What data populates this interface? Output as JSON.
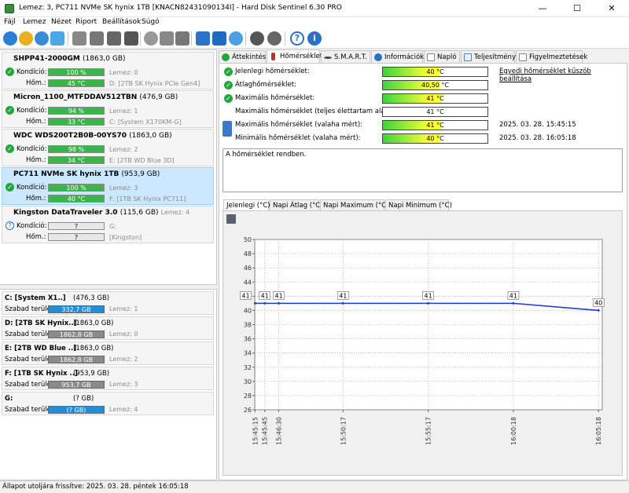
{
  "window": {
    "title": "Lemez: 3, PC711 NVMe SK hynix 1TB [KNACN82431090134I] - Hard Disk Sentinel 6.30 PRO",
    "minimize": "—",
    "maximize": "☐",
    "close": "✕"
  },
  "menu": [
    "Fájl",
    "Lemez",
    "Nézet",
    "Riport",
    "Beállítások",
    "Súgó"
  ],
  "toolbar_icons": [
    "refresh-icon",
    "refresh-all-icon",
    "info-icon",
    "report-icon",
    "disk-test-icon",
    "disk-eject-icon",
    "disk-warning-icon",
    "disk-settings-icon",
    "network-disk-icon",
    "usb-icon",
    "disk-tools-icon",
    "clipboard-icon",
    "email-icon",
    "cloud-icon",
    "settings-gear-icon",
    "alert-settings-icon",
    "help-icon",
    "about-icon"
  ],
  "disks": [
    {
      "name": "SHPP41-2000GM",
      "size": "(1863,0 GB)",
      "condition_label": "Kondíció:",
      "condition": "100 %",
      "disk_no": "Lemez: 0",
      "temp_label": "Hőm.:",
      "temp": "45 °C",
      "volume": "D: [2TB SK Hynix PCIe Gen4]",
      "status": "ok"
    },
    {
      "name": "Micron_1100_MTFDDAV512TBN",
      "size": "(476,9 GB)",
      "condition_label": "Kondíció:",
      "condition": "94 %",
      "disk_no": "Lemez: 1",
      "temp_label": "Hőm.:",
      "temp": "33 °C",
      "volume": "C: [System X170KM-G]",
      "status": "ok"
    },
    {
      "name": "WDC WDS200T2B0B-00YS70",
      "size": "(1863,0 GB)",
      "condition_label": "Kondíció:",
      "condition": "98 %",
      "disk_no": "Lemez: 2",
      "temp_label": "Hőm.:",
      "temp": "34 °C",
      "volume": "E: [2TB WD Blue 3D]",
      "status": "ok"
    },
    {
      "name": "PC711 NVMe SK hynix 1TB",
      "size": "(953,9 GB)",
      "condition_label": "Kondíció:",
      "condition": "100 %",
      "disk_no": "Lemez: 3",
      "temp_label": "Hőm.:",
      "temp": "40 °C",
      "volume": "F: [1TB SK Hynix PC711]",
      "status": "ok"
    },
    {
      "name": "Kingston DataTraveler 3.0",
      "size": "(115,6 GB)",
      "condition_label": "Kondíció:",
      "condition": "?",
      "disk_no": "Lemez: 4",
      "temp_label": "Hőm.:",
      "temp": "?",
      "volume_a": "G:",
      "volume": "[Kingston]",
      "status": "unknown"
    }
  ],
  "volumes": [
    {
      "name": "C: [System X1..]",
      "size": "(476,3 GB)",
      "free_label": "Szabad terület",
      "free": "332,7 GB",
      "disk": "Lemez: 1",
      "color": "blue"
    },
    {
      "name": "D: [2TB SK Hynix..]",
      "size": "(1863,0 GB)",
      "free_label": "Szabad terület",
      "free": "1862,8 GB",
      "disk": "Lemez: 0",
      "color": "gray"
    },
    {
      "name": "E: [2TB WD Blue ..]",
      "size": "(1863,0 GB)",
      "free_label": "Szabad terület",
      "free": "1862,8 GB",
      "disk": "Lemez: 2",
      "color": "gray"
    },
    {
      "name": "F: [1TB SK Hynix ..]",
      "size": "(953,9 GB)",
      "free_label": "Szabad terület",
      "free": "953,7 GB",
      "disk": "Lemez: 3",
      "color": "gray"
    },
    {
      "name": "G:",
      "size": "(? GB)",
      "free_label": "Szabad terület",
      "free": "(? GB)",
      "disk": "Lemez: 4",
      "color": "blue"
    }
  ],
  "tabs": [
    "Áttekintés",
    "Hőmérséklet",
    "S.M.A.R.T.",
    "Információk",
    "Napló",
    "Teljesítmény",
    "Figyelmeztetések"
  ],
  "temperature": {
    "rows": [
      {
        "label": "Jelenlegi hőmérséklet:",
        "value": "40 °C",
        "fill": 0.4
      },
      {
        "label": "Átlaghőmérséklet:",
        "value": "40,50 °C",
        "fill": 0.405
      },
      {
        "label": "Maximális hőmérséklet:",
        "value": "41 °C",
        "fill": 0.41
      },
      {
        "label": "Maximális hőmérséklet (teljes élettartam alatt):",
        "value": "41 °C",
        "fill": null
      },
      {
        "label": "Maximális hőmérséklet (valaha mért):",
        "value": "41 °C",
        "fill": 0.41
      },
      {
        "label": "Minimális hőmérséklet (valaha mért):",
        "value": "40 °C",
        "fill": 0.4
      }
    ],
    "threshold_link": "Egyedi hőmérséklet küszöb beállítása",
    "ts_max": "2025. 03. 28. 15:45:15",
    "ts_min": "2025. 03. 28. 16:05:18",
    "message": "A hőmérséklet rendben."
  },
  "chart_tabs": [
    "Jelenlegi (°C)",
    "Napi Átlag (°C)",
    "Napi Maximum (°C)",
    "Napi Minimum (°C)"
  ],
  "chart_data": {
    "type": "line",
    "x": [
      "15:45:15",
      "15:45:45",
      "15:46:30",
      "15:50:17",
      "15:55:17",
      "16:00:18",
      "16:05:18"
    ],
    "values": [
      41,
      41,
      41,
      41,
      41,
      41,
      40
    ],
    "point_labels": [
      "41",
      "41",
      "41",
      "41",
      "41",
      "41",
      "40"
    ],
    "ylim": [
      26,
      50
    ],
    "yticks": [
      26,
      28,
      30,
      32,
      34,
      36,
      38,
      40,
      42,
      44,
      46,
      48,
      50
    ],
    "grid": true,
    "line_color": "#1a3ccc"
  },
  "status_bar": "Állapot utoljára frissítve: 2025. 03. 28. péntek 16:05:18"
}
